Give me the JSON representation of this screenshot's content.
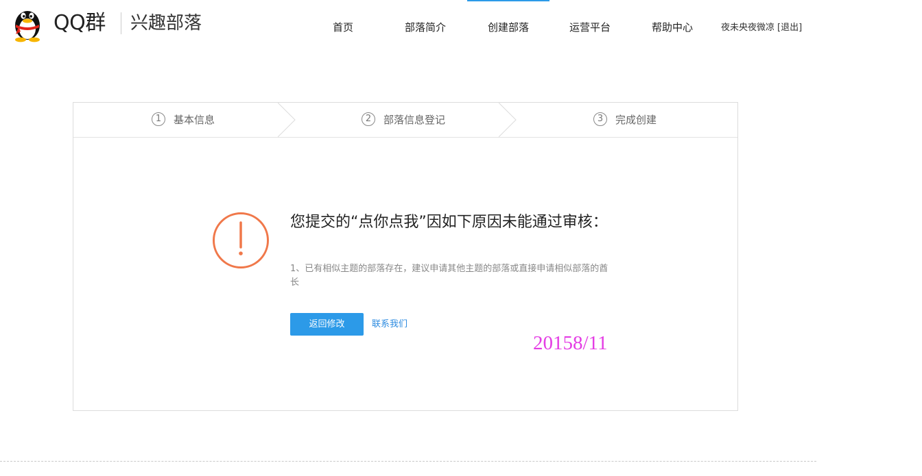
{
  "header": {
    "brand": "QQ群",
    "sub_brand": "兴趣部落",
    "nav": [
      {
        "label": "首页",
        "active": false
      },
      {
        "label": "部落简介",
        "active": false
      },
      {
        "label": "创建部落",
        "active": true
      },
      {
        "label": "运营平台",
        "active": false
      },
      {
        "label": "帮助中心",
        "active": false
      }
    ],
    "username": "夜未央夜微凉",
    "logout": "[退出]"
  },
  "steps": [
    {
      "num": "1",
      "label": "基本信息"
    },
    {
      "num": "2",
      "label": "部落信息登记"
    },
    {
      "num": "3",
      "label": "完成创建"
    }
  ],
  "message": {
    "title": "您提交的“点你点我”因如下原因未能通过审核：",
    "reason": "1、已有相似主题的部落存在，建议申请其他主题的部落或直接申请相似部落的酋长",
    "back_button": "返回修改",
    "contact_link": "联系我们"
  },
  "stamp": "20158/11",
  "colors": {
    "accent": "#2c9ae8",
    "alert": "#f0784a",
    "stamp": "#e43de4"
  },
  "icons": {
    "logo": "qq-penguin-icon",
    "alert": "exclamation-circle-icon",
    "separator": "chevron-right-icon"
  }
}
